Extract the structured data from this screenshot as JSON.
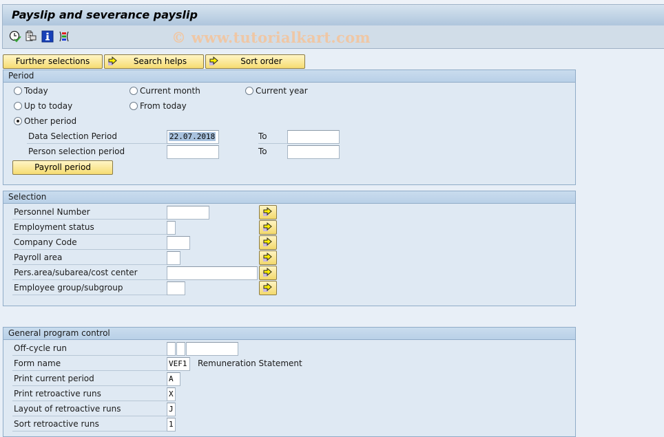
{
  "window": {
    "title": "Payslip and severance payslip",
    "watermark": "© www.tutorialkart.com"
  },
  "toolbar": {
    "icons": [
      "execute-clock-icon",
      "get-variant-icon",
      "info-icon",
      "selection-options-icon"
    ]
  },
  "top_buttons": {
    "further_selections": "Further selections",
    "search_helps": "Search helps",
    "sort_order": "Sort order"
  },
  "period": {
    "header": "Period",
    "radios": {
      "today": "Today",
      "current_month": "Current month",
      "current_year": "Current year",
      "up_to_today": "Up to today",
      "from_today": "From today",
      "other_period": "Other period"
    },
    "selected": "other_period",
    "data_selection_label": "Data Selection Period",
    "data_selection_from": "22.07.2018",
    "data_selection_to": "",
    "person_selection_label": "Person selection period",
    "person_selection_from": "",
    "person_selection_to": "",
    "to_label": "To",
    "payroll_period_button": "Payroll period"
  },
  "selection": {
    "header": "Selection",
    "fields": [
      {
        "label": "Personnel Number",
        "value": ""
      },
      {
        "label": "Employment status",
        "value": ""
      },
      {
        "label": "Company Code",
        "value": ""
      },
      {
        "label": "Payroll area",
        "value": ""
      },
      {
        "label": "Pers.area/subarea/cost center",
        "value": ""
      },
      {
        "label": "Employee group/subgroup",
        "value": ""
      }
    ]
  },
  "program_control": {
    "header": "General program control",
    "offcycle_label": "Off-cycle run",
    "offcycle_values": [
      "",
      "",
      ""
    ],
    "form_name_label": "Form name",
    "form_name_value": "VEF1",
    "form_name_desc": "Remuneration Statement",
    "print_current_label": "Print current period",
    "print_current_value": "A",
    "print_retro_label": "Print retroactive runs",
    "print_retro_value": "X",
    "layout_retro_label": "Layout of retroactive runs",
    "layout_retro_value": "J",
    "sort_retro_label": "Sort retroactive runs",
    "sort_retro_value": "1"
  },
  "colors": {
    "accent_button": "#f6dc72",
    "group_header": "#c9dcee",
    "background": "#e8eff7"
  }
}
